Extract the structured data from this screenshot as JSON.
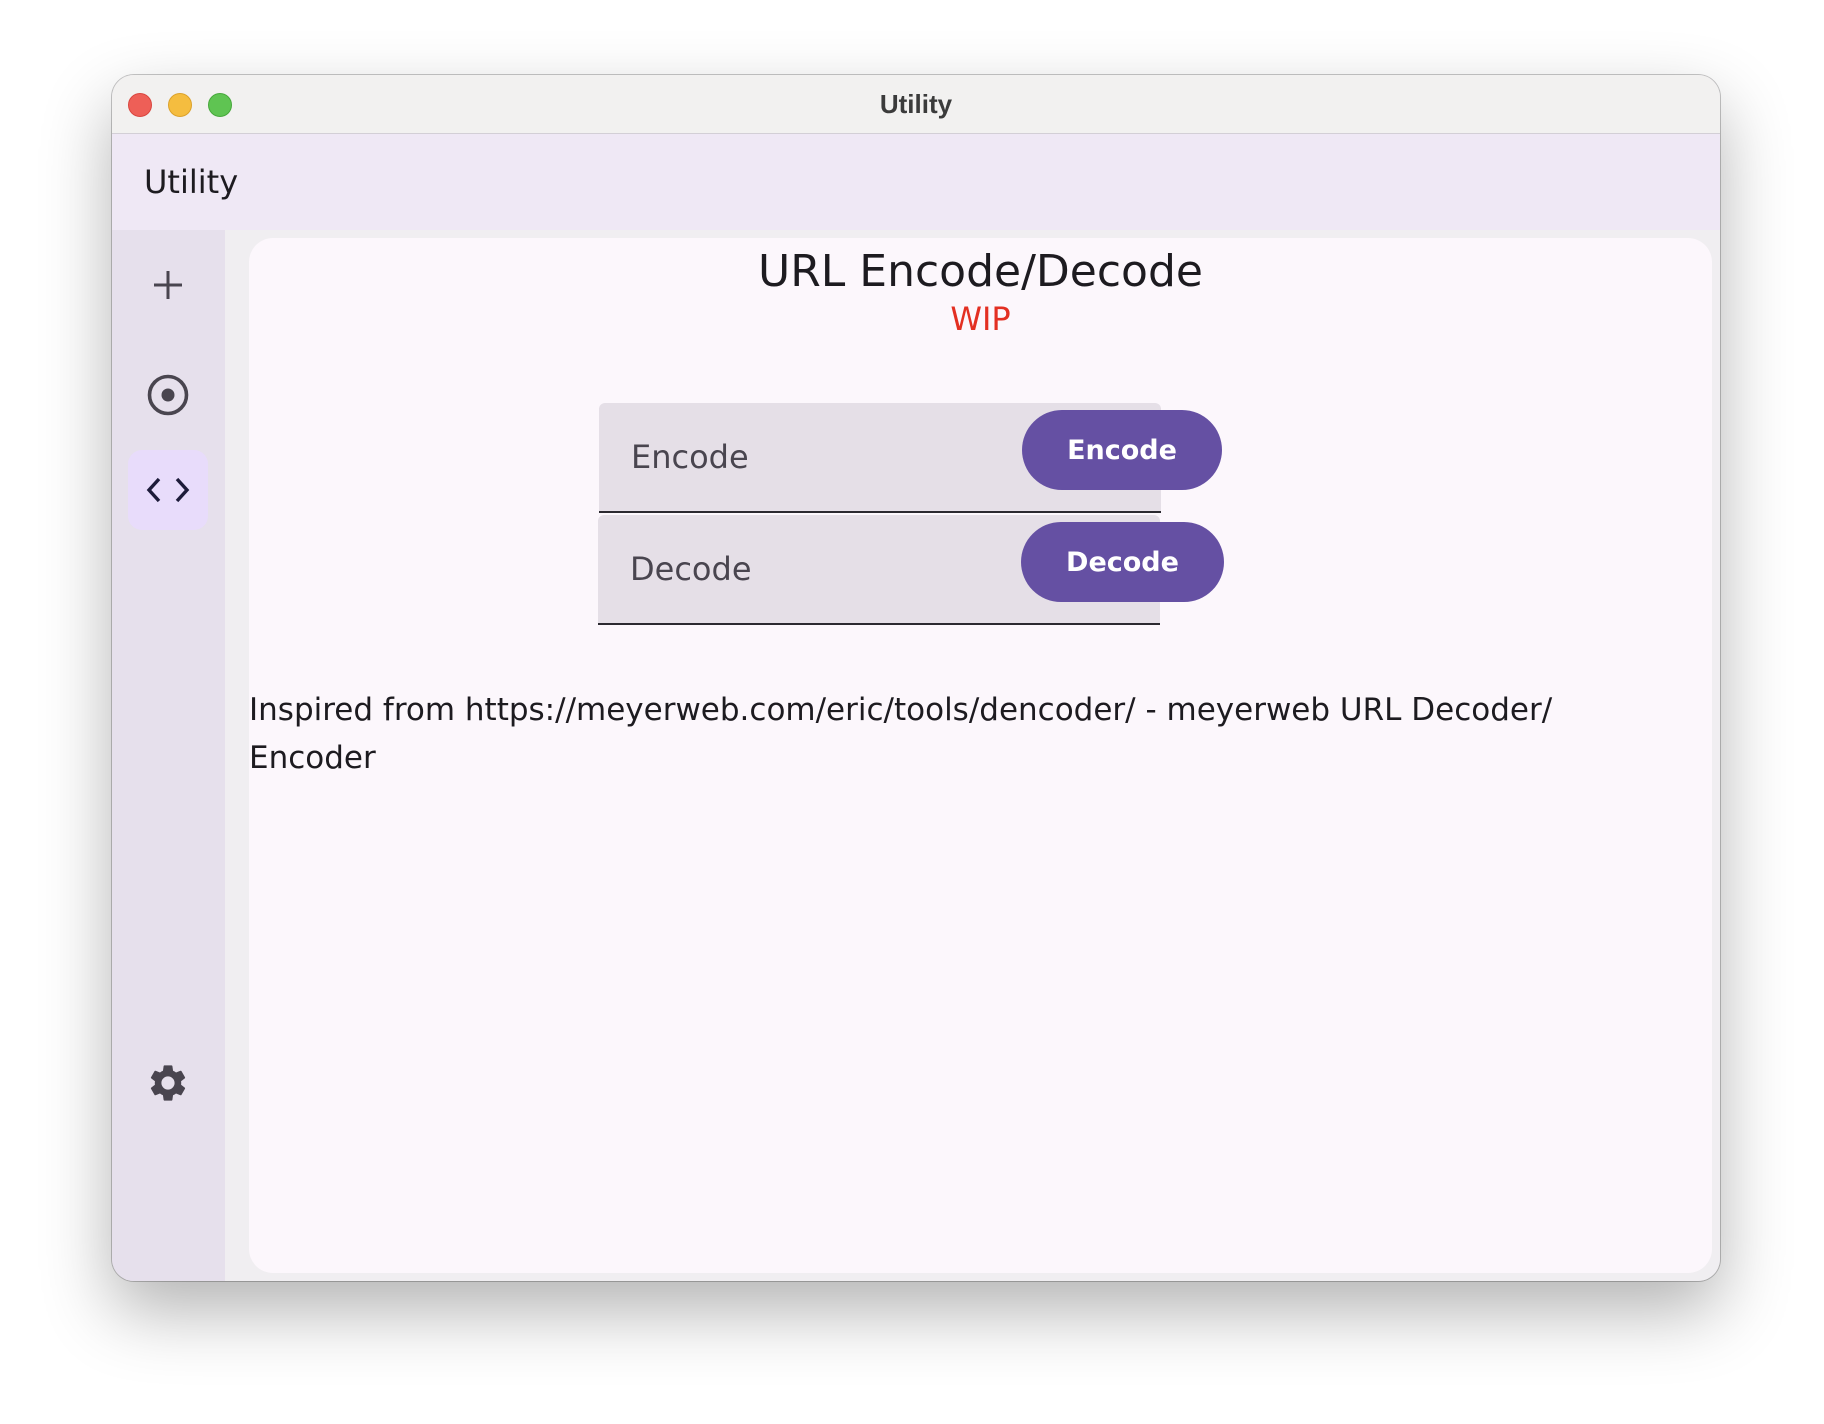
{
  "window": {
    "title": "Utility"
  },
  "appbar": {
    "title": "Utility"
  },
  "rail": {
    "items": [
      {
        "icon": "plus-icon"
      },
      {
        "icon": "radio-button-icon"
      },
      {
        "icon": "code-icon",
        "selected": true
      }
    ],
    "footer_icon": "gear-icon"
  },
  "main": {
    "title": "URL Encode/Decode",
    "status": "WIP",
    "encode_field": {
      "placeholder": "Encode",
      "value": ""
    },
    "decode_field": {
      "placeholder": "Decode",
      "value": ""
    },
    "encode_button": "Encode",
    "decode_button": "Decode",
    "credit": "Inspired from https://meyerweb.com/eric/tools/dencoder/ - meyerweb URL Decoder/ Encoder"
  },
  "colors": {
    "accent": "#6550a3",
    "status": "#e32f22",
    "rail_bg": "#e6e0ec",
    "appbar_bg": "#efe8f5",
    "content_bg": "#fcf7fc"
  }
}
